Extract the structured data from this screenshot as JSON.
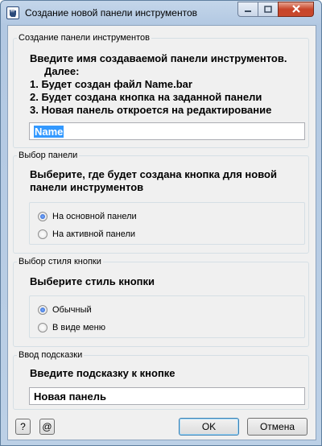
{
  "window": {
    "title": "Создание новой панели инструментов"
  },
  "group_create": {
    "legend": "Создание панели инструментов",
    "instructions": [
      "Введите имя создаваемой панели инструментов.",
      "     Далее:",
      "1. Будет создан файл Name.bar",
      "2. Будет создана кнопка на заданной панели",
      "3. Новая панель откроется на редактирование"
    ],
    "name_value": "Name"
  },
  "group_panel": {
    "legend": "Выбор панели",
    "prompt_line1": "Выберите, где будет создана кнопка для новой",
    "prompt_line2": "панели инструментов",
    "options": [
      {
        "label": "На основной панели",
        "checked": true
      },
      {
        "label": "На активной панели",
        "checked": false
      }
    ]
  },
  "group_style": {
    "legend": "Выбор стиля кнопки",
    "prompt": "Выберите стиль кнопки",
    "options": [
      {
        "label": "Обычный",
        "checked": true
      },
      {
        "label": "В виде меню",
        "checked": false
      }
    ]
  },
  "group_hint": {
    "legend": "Ввод подсказки",
    "prompt": "Введите подсказку к кнопке",
    "hint_value": "Новая панель"
  },
  "buttons": {
    "help": "?",
    "at": "@",
    "ok": "OK",
    "cancel": "Отмена"
  }
}
